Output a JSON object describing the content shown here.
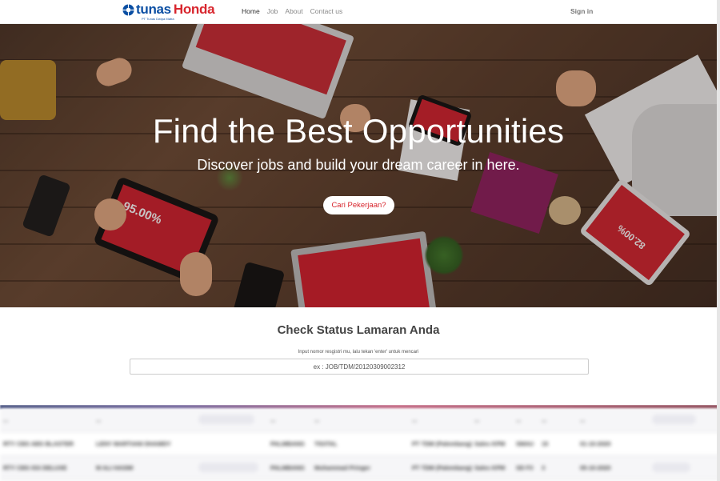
{
  "navbar": {
    "brand_tunas": "tunas",
    "brand_honda": "Honda",
    "brand_subtitle": "PT Tunas Dwipa Matra",
    "links": [
      "Home",
      "Job",
      "About",
      "Contact us"
    ],
    "active_link": "Home",
    "signin_label": "Sign in",
    "colors": {
      "tunas_blue": "#0a4ea3",
      "honda_red": "#d8262e"
    }
  },
  "hero": {
    "title": "Find the Best Opportunities",
    "subtitle": "Discover jobs and build your dream career in here.",
    "cta_label": "Cari Pekerjaan?",
    "tablet_left_text": "95.00%",
    "tablet_right_text": "82.00%"
  },
  "status": {
    "title": "Check Status Lamaran Anda",
    "hint": "Input nomor resgistri mu, lalu tekan 'enter' untuk mencari",
    "input_placeholder": "ex : JOB/TDM/20120309002312"
  },
  "table": {
    "rows": [
      [
        "...",
        "...",
        "...",
        "...",
        "...",
        "...",
        "...",
        "...",
        "..."
      ],
      [
        "RTY CBS ABS BLASTER",
        "LENY MARTIANI DHAMDY",
        "PALMBANG",
        "TIGITAL",
        "PT TDM (Palembang)",
        "Sales KPM",
        "SMAU",
        "15",
        "01-10-2020"
      ],
      [
        "RTY CBS ISS DELUXE",
        "M ALI HASIM",
        "PALMBANG",
        "Muhammad Pringer",
        "PT TDM (Palembang)",
        "Sales KPM",
        "SD F3",
        "3",
        "05-10-2020"
      ]
    ]
  }
}
